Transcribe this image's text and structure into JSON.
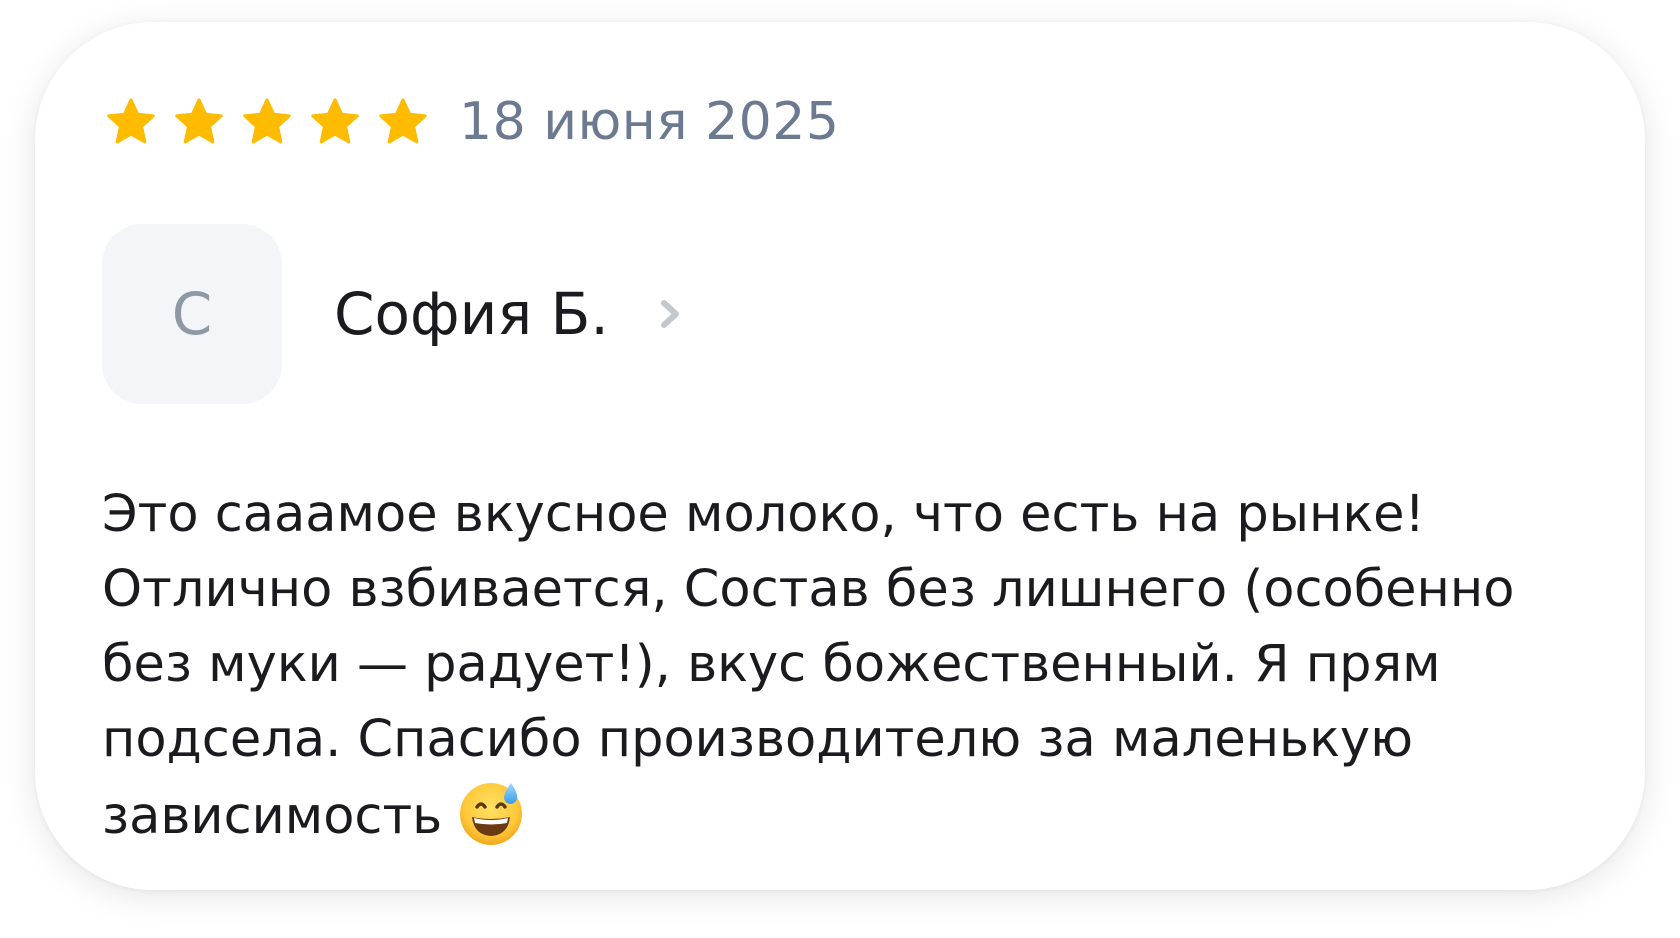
{
  "review": {
    "rating": 5,
    "rating_max": 5,
    "date": "18 июня 2025",
    "author_initial": "С",
    "author_name": "София Б.",
    "text": "Это сааамое вкусное молоко, что есть на рынке!\nОтлично взбивается, Состав без лишнего (особенно\nбез муки — радует!), вкус божественный. Я прям\nподсела. Спасибо производителю за маленькую\nзависимость",
    "emoji": "grinning-face-with-sweat"
  },
  "colors": {
    "star": "#ffbb00",
    "date_text": "#6b7a90",
    "avatar_bg": "#f3f5f8",
    "avatar_text": "#8f99a6",
    "chevron": "#c4c8ce",
    "body_text": "#1b1b1f"
  },
  "icons": {
    "star": "star-icon",
    "chevron": "chevron-right-icon"
  }
}
